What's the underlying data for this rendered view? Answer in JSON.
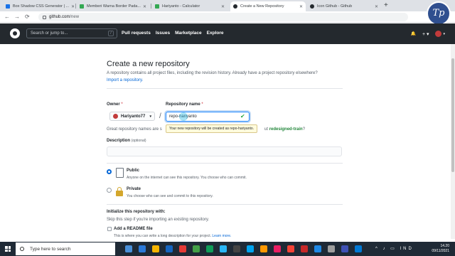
{
  "browser": {
    "tabs": [
      {
        "label": "Box Shadow CSS Generator | ...",
        "favicon_color": "#1a73e8",
        "active": false
      },
      {
        "label": "Memberi Warna Border Pada...",
        "favicon_color": "#34a853",
        "active": false
      },
      {
        "label": "Hariyanto - Calculator",
        "favicon_color": "#34a853",
        "active": false
      },
      {
        "label": "Create a New Repository",
        "favicon_color": "#24292e",
        "active": true
      },
      {
        "label": "Icon Github - Github",
        "favicon_color": "#24292e",
        "active": false
      }
    ],
    "new_tab": "+",
    "url_domain": "github.com",
    "url_path": "/new",
    "back": "←",
    "forward": "→",
    "reload": "⟳"
  },
  "github_header": {
    "search_placeholder": "Search or jump to...",
    "search_key": "/",
    "nav": [
      "Pull requests",
      "Issues",
      "Marketplace",
      "Explore"
    ],
    "bell": "🔔",
    "plus": "+ ▾",
    "avatar_caret": "▾"
  },
  "brand_watermark": "Tp",
  "page": {
    "title": "Create a new repository",
    "subtitle": "A repository contains all project files, including the revision history. Already have a project repository elsewhere?",
    "import_link": "Import a repository.",
    "owner_label": "Owner",
    "repo_label": "Repository name",
    "required_mark": "*",
    "owner_value": "Hariyanto77",
    "owner_caret": "▾",
    "slash": "/",
    "repo_value": "repo-hariyanto",
    "check": "✔",
    "tooltip": "Your new repository will be created as repo-hariyanto.",
    "great_names": "Great repository names are s",
    "suggestion_tail": "ut",
    "suggestion_name": "redesigned-train",
    "suggestion_end": "?",
    "description_label": "Description",
    "description_optional": "(optional)",
    "description_value": "",
    "visibility": {
      "public_title": "Public",
      "public_desc": "Anyone on the internet can see this repository. You choose who can commit.",
      "private_title": "Private",
      "private_desc": "You choose who can see and commit to this repository.",
      "selected": "public"
    },
    "init_title": "Initialize this repository with:",
    "init_desc": "Skip this step if you're importing an existing repository.",
    "readme_label": "Add a README file",
    "readme_desc": "This is where you can write a long description for your project.",
    "readme_link": "Learn more."
  },
  "taskbar": {
    "search_placeholder": "Type here to search",
    "apps": [
      "#4a90d9",
      "#2b79d8",
      "#f5b400",
      "#1565c0",
      "#e53935",
      "#43a047",
      "#0f9d58",
      "#29b6f6",
      "#444",
      "#00a4ef",
      "#ff9800",
      "#e91e63",
      "#f44336",
      "#c62828",
      "#1e88e5",
      "#9e9e9e",
      "#3f51b5",
      "#0078d4"
    ],
    "time": "14.20",
    "date": "09/11/2021",
    "tray": "^ ♪ ▭ IND"
  }
}
